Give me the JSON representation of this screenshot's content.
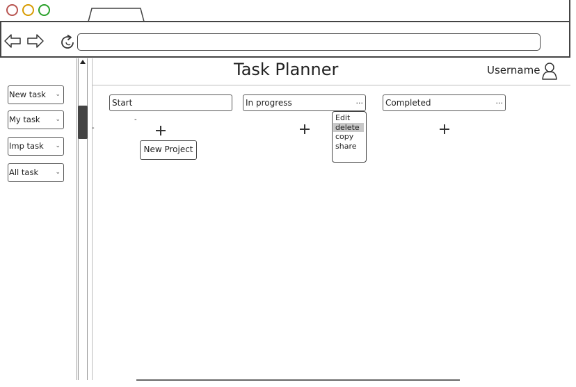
{
  "window": {
    "controls": [
      "close-icon",
      "minimize-icon",
      "maximize-icon"
    ],
    "tab_label": ""
  },
  "toolbar": {
    "back_icon": "arrow-left-icon",
    "forward_icon": "arrow-right-icon",
    "reload_icon": "reload-icon",
    "url_value": ""
  },
  "header": {
    "title": "Task Planner",
    "username": "Username",
    "user_icon": "user-icon"
  },
  "sidebar": {
    "items": [
      {
        "label": "New task"
      },
      {
        "label": "My task"
      },
      {
        "label": "Imp task"
      },
      {
        "label": "All task"
      }
    ]
  },
  "columns": [
    {
      "label": "Start",
      "more": ""
    },
    {
      "label": "In progress",
      "more": "..."
    },
    {
      "label": "Completed",
      "more": "..."
    }
  ],
  "start_column": {
    "button_label": "New Project",
    "marks": [
      "-",
      "-"
    ]
  },
  "context_menu": {
    "items": [
      {
        "label": "Edit",
        "highlighted": false
      },
      {
        "label": "delete",
        "highlighted": true
      },
      {
        "label": "copy",
        "highlighted": false
      },
      {
        "label": "share",
        "highlighted": false
      }
    ]
  },
  "colors": {
    "close": "#b85450",
    "minimize": "#d79b00",
    "maximize": "#2aa02a",
    "highlight": "#c8c8c8",
    "border": "#444444"
  }
}
